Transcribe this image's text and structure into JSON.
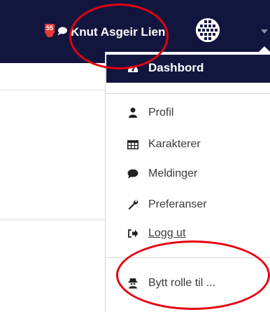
{
  "navbar": {
    "notification_count": "55",
    "user_name": "Knut Asgeir Lien",
    "background": "#12163e"
  },
  "user_menu": {
    "items": [
      {
        "label": "Dashbord",
        "icon": "dashboard-icon",
        "active": true
      },
      {
        "label": "Profil",
        "icon": "user-icon"
      },
      {
        "label": "Karakterer",
        "icon": "table-icon"
      },
      {
        "label": "Meldinger",
        "icon": "comment-icon"
      },
      {
        "label": "Preferanser",
        "icon": "wrench-icon"
      },
      {
        "label": "Logg ut",
        "icon": "sign-out-icon"
      },
      {
        "label": "Bytt rolle til ...",
        "icon": "user-secret-icon"
      }
    ]
  },
  "annotations": {
    "ellipse_color": "#e3000f"
  }
}
